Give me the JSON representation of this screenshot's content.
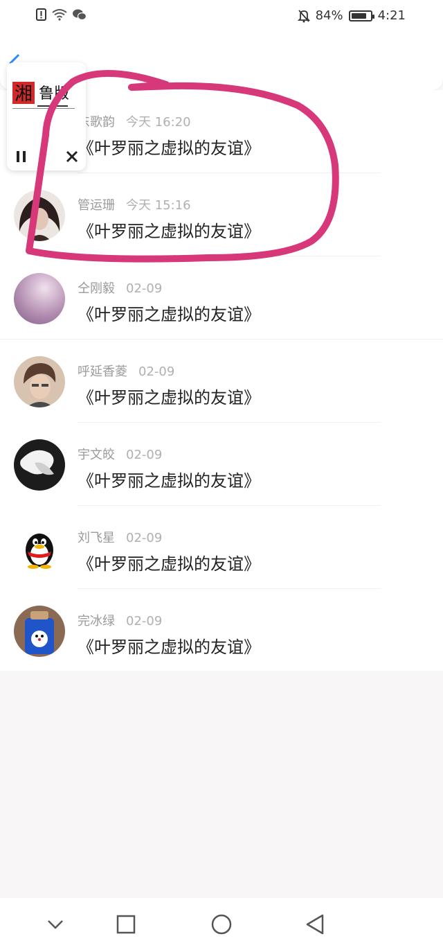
{
  "status_bar": {
    "battery_percent": "84%",
    "time": "4:21",
    "battery_level": 0.84,
    "icons": [
      "alert-icon",
      "wifi-icon",
      "wechat-icon",
      "mute-icon",
      "battery-icon"
    ]
  },
  "header": {
    "back_icon": "chevron-left-icon"
  },
  "mini_player": {
    "logo_char": "湘",
    "logo_title": "鲁版",
    "controls": [
      "pause-icon",
      "close-icon"
    ]
  },
  "messages": [
    {
      "name": "东歌韵",
      "date": "今天 16:20",
      "text": "《叶罗丽之虚拟的友谊》"
    },
    {
      "name": "管运珊",
      "date": "今天 15:16",
      "text": "《叶罗丽之虚拟的友谊》"
    },
    {
      "name": "仝刚毅",
      "date": "02-09",
      "text": "《叶罗丽之虚拟的友谊》"
    },
    {
      "name": "呼延香菱",
      "date": "02-09",
      "text": "《叶罗丽之虚拟的友谊》"
    },
    {
      "name": "宇文皎",
      "date": "02-09",
      "text": "《叶罗丽之虚拟的友谊》"
    },
    {
      "name": "刘飞星",
      "date": "02-09",
      "text": "《叶罗丽之虚拟的友谊》"
    },
    {
      "name": "完冰绿",
      "date": "02-09",
      "text": "《叶罗丽之虚拟的友谊》"
    }
  ],
  "nav_bar": {
    "buttons": [
      "collapse-icon",
      "recent-apps-icon",
      "home-icon",
      "back-icon"
    ]
  },
  "colors": {
    "accent": "#2b8ef4",
    "annotation": "#d6387a",
    "text_primary": "#222222",
    "text_secondary": "#9a9a9a",
    "page_background": "#f8f6f7"
  }
}
